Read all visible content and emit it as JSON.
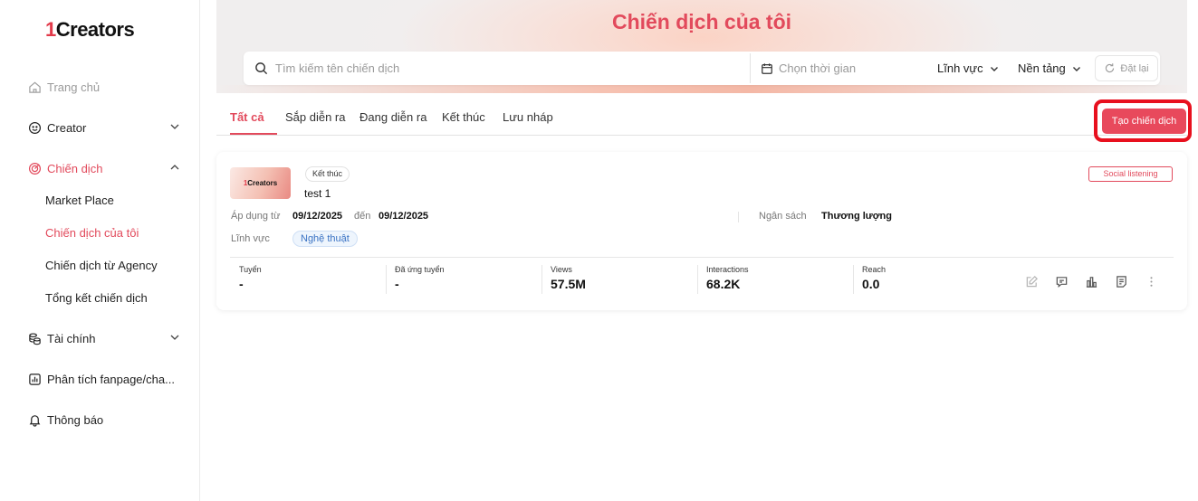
{
  "app": {
    "logo_digit": "1",
    "logo_text": "Creators"
  },
  "sidebar": {
    "items": [
      {
        "label": "Trang chủ"
      },
      {
        "label": "Creator"
      },
      {
        "label": "Chiến dịch"
      },
      {
        "label": "Tài chính"
      },
      {
        "label": "Phân tích fanpage/cha..."
      },
      {
        "label": "Thông báo"
      }
    ],
    "campaign_sub": [
      {
        "label": "Market Place"
      },
      {
        "label": "Chiến dịch của tôi"
      },
      {
        "label": "Chiến dịch từ Agency"
      },
      {
        "label": "Tổng kết chiến dịch"
      }
    ]
  },
  "header": {
    "title": "Chiến dịch của tôi",
    "search_placeholder": "Tìm kiếm tên chiến dịch",
    "date_placeholder": "Chọn thời gian",
    "filter_field": "Lĩnh vực",
    "filter_platform": "Nền tảng",
    "reset_label": "Đặt lại"
  },
  "tabs": [
    {
      "label": "Tất cả"
    },
    {
      "label": "Sắp diễn ra"
    },
    {
      "label": "Đang diễn ra"
    },
    {
      "label": "Kết thúc"
    },
    {
      "label": "Lưu nháp"
    }
  ],
  "create_button": "Tạo chiến dịch",
  "campaign": {
    "thumb_digit": "1",
    "thumb_text": "Creators",
    "status": "Kết thúc",
    "name": "test 1",
    "tag": "Social listening",
    "apply_from_label": "Áp dụng từ",
    "start_date": "09/12/2025",
    "to_label": "đến",
    "end_date": "09/12/2025",
    "budget_label": "Ngân sách",
    "budget_value": "Thương lượng",
    "field_label": "Lĩnh vực",
    "field_value": "Nghệ thuật",
    "stats": [
      {
        "label": "Tuyển",
        "value": "-"
      },
      {
        "label": "Đã ứng tuyển",
        "value": "-"
      },
      {
        "label": "Views",
        "value": "57.5M"
      },
      {
        "label": "Interactions",
        "value": "68.2K"
      },
      {
        "label": "Reach",
        "value": "0.0"
      }
    ]
  },
  "colors": {
    "accent": "#e24a5c",
    "highlight": "#e8101e",
    "chip_blue": "#3b73c4"
  },
  "icons": [
    "home-icon",
    "smiley-icon",
    "target-icon",
    "coins-icon",
    "chart-icon",
    "bell-icon",
    "search-icon",
    "calendar-icon",
    "refresh-icon",
    "edit-icon",
    "comment-icon",
    "bar-chart-icon",
    "report-icon",
    "more-icon"
  ]
}
